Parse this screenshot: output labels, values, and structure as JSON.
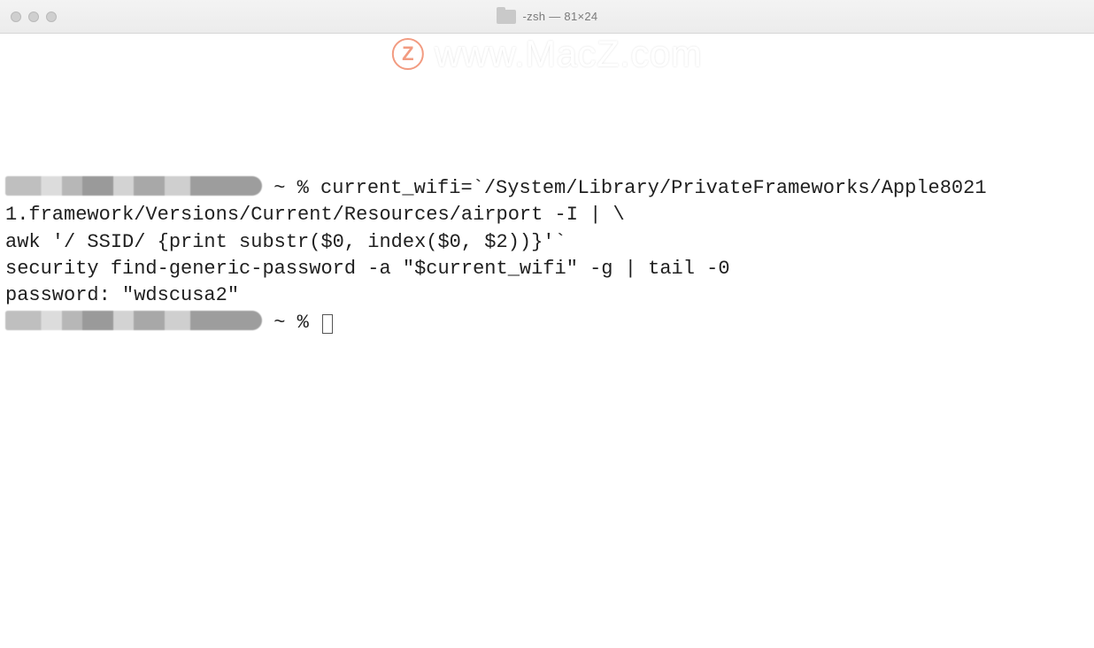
{
  "window": {
    "title": "-zsh — 81×24"
  },
  "watermark": {
    "badge_letter": "Z",
    "text": "www.MacZ.com"
  },
  "terminal": {
    "prompt_tail": " ~ % ",
    "line1_after_prompt": "current_wifi=`/System/Library/PrivateFrameworks/Apple8021",
    "line2": "1.framework/Versions/Current/Resources/airport -I | \\",
    "line3": "awk '/ SSID/ {print substr($0, index($0, $2))}'`",
    "line4": "security find-generic-password -a \"$current_wifi\" -g | tail -0",
    "line5": "password: \"wdscusa2\"",
    "prompt2_tail": " ~ % "
  }
}
